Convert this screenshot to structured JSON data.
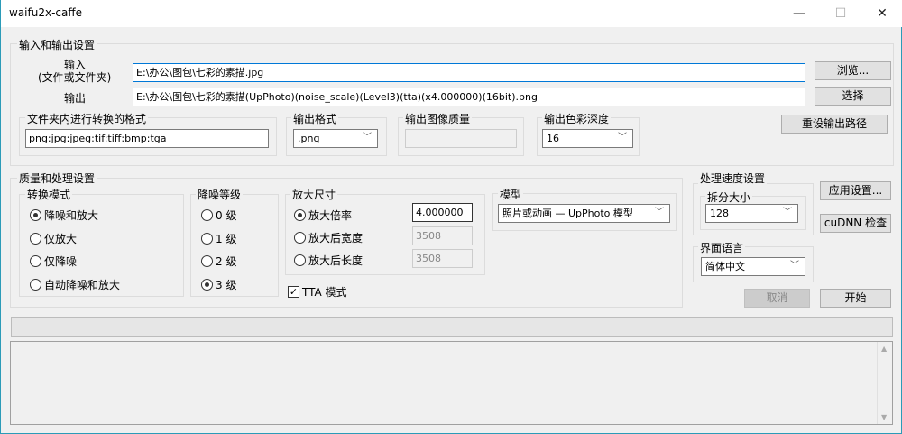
{
  "window": {
    "title": "waifu2x-caffe",
    "minimize": "—",
    "maximize": "☐",
    "close": "✕"
  },
  "io": {
    "legend": "输入和输出设置",
    "input_label_1": "输入",
    "input_label_2": "(文件或文件夹)",
    "input_value": "E:\\办公\\图包\\七彩的素描.jpg",
    "browse": "浏览...",
    "output_label": "输出",
    "output_value": "E:\\办公\\图包\\七彩的素描(UpPhoto)(noise_scale)(Level3)(tta)(x4.000000)(16bit).png",
    "select": "选择",
    "folder_formats_legend": "文件夹内进行转换的格式",
    "folder_formats": "png:jpg:jpeg:tif:tiff:bmp:tga",
    "out_format_legend": "输出格式",
    "out_format": ".png",
    "out_quality_legend": "输出图像质量",
    "out_quality": "",
    "depth_legend": "输出色彩深度",
    "depth": "16",
    "reset_path": "重设输出路径"
  },
  "quality": {
    "legend": "质量和处理设置",
    "mode_legend": "转换模式",
    "modes": [
      {
        "label": "降噪和放大",
        "checked": true
      },
      {
        "label": "仅放大",
        "checked": false
      },
      {
        "label": "仅降噪",
        "checked": false
      },
      {
        "label": "自动降噪和放大",
        "checked": false
      }
    ],
    "noise_legend": "降噪等级",
    "noise": [
      {
        "label": "0 级",
        "checked": false
      },
      {
        "label": "1 级",
        "checked": false
      },
      {
        "label": "2 级",
        "checked": false
      },
      {
        "label": "3 级",
        "checked": true
      }
    ],
    "scale_legend": "放大尺寸",
    "scale": [
      {
        "label": "放大倍率",
        "checked": true,
        "value": "4.000000"
      },
      {
        "label": "放大后宽度",
        "checked": false,
        "value": "3508"
      },
      {
        "label": "放大后长度",
        "checked": false,
        "value": "3508"
      }
    ],
    "tta": "TTA 模式",
    "tta_checked": true,
    "model_legend": "模型",
    "model": "照片或动画 — UpPhoto 模型"
  },
  "speed": {
    "legend": "处理速度设置",
    "split_legend": "拆分大小",
    "split": "128"
  },
  "lang": {
    "legend": "界面语言",
    "value": "简体中文"
  },
  "buttons": {
    "apply": "应用设置...",
    "cudnn": "cuDNN 检查",
    "cancel": "取消",
    "start": "开始"
  },
  "progress": 0,
  "log": ""
}
